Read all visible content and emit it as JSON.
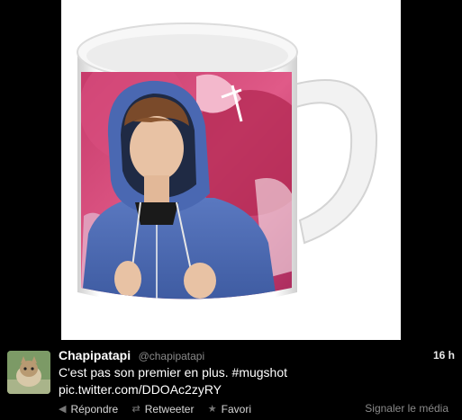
{
  "tweet": {
    "display_name": "Chapipatapi",
    "screen_name": "@chapipatapi",
    "timestamp": "16 h",
    "text_line1": "C'est pas son premier en plus. #mugshot",
    "text_line2": "pic.twitter.com/DDOAc2zyRY"
  },
  "actions": {
    "reply": "Répondre",
    "retweet": "Retweeter",
    "favorite": "Favori",
    "report": "Signaler le média"
  },
  "icons": {
    "reply": "reply-arrow-icon",
    "retweet": "retweet-icon",
    "favorite": "star-icon"
  },
  "colors": {
    "background": "#000000",
    "text": "#ffffff",
    "muted": "#8a8a8a"
  }
}
